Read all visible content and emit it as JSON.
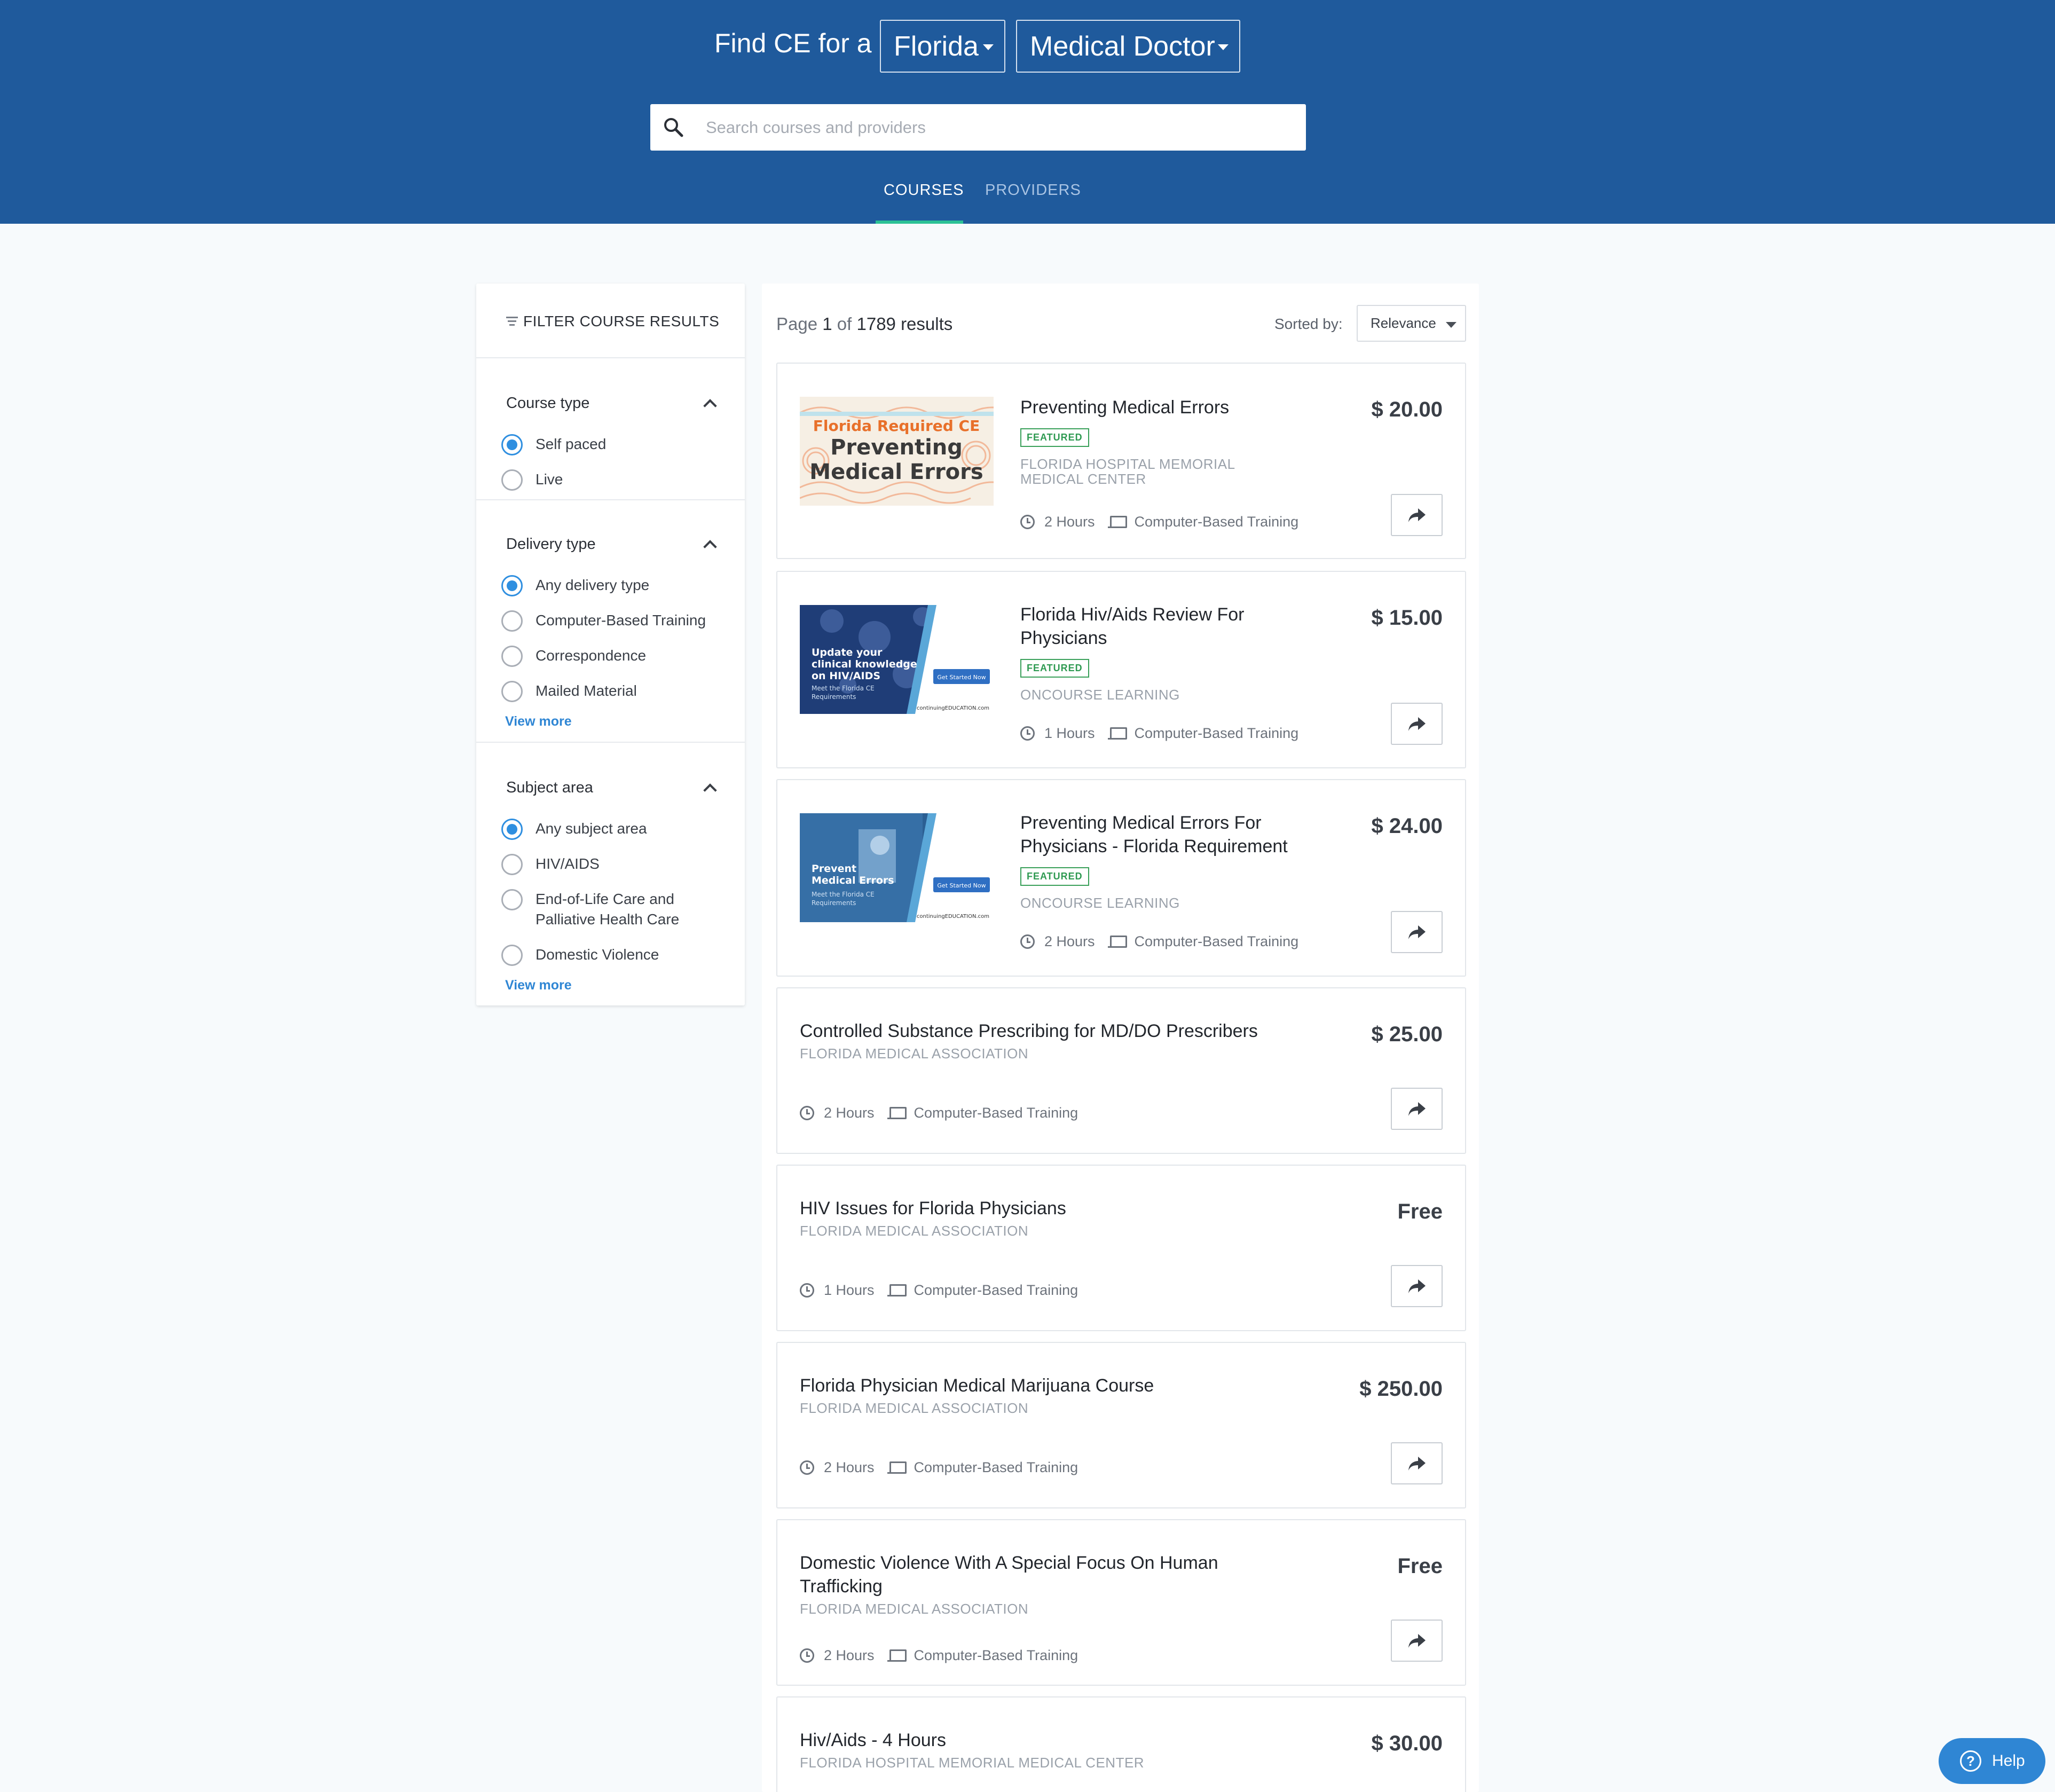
{
  "header": {
    "find_label": "Find CE for a",
    "state": "Florida",
    "profession": "Medical Doctor",
    "search_placeholder": "Search courses and providers",
    "tabs": [
      "COURSES",
      "PROVIDERS"
    ],
    "active_tab": "COURSES"
  },
  "sidebar": {
    "title": "FILTER COURSE RESULTS",
    "course_type": {
      "title": "Course type",
      "options": [
        "Self paced",
        "Live"
      ],
      "selected": "Self paced"
    },
    "delivery_type": {
      "title": "Delivery type",
      "options": [
        "Any delivery type",
        "Computer-Based Training",
        "Correspondence",
        "Mailed Material"
      ],
      "selected": "Any delivery type",
      "view_more": "View more"
    },
    "subject_area": {
      "title": "Subject area",
      "options": [
        "Any subject area",
        "HIV/AIDS",
        "End-of-Life Care and",
        "Palliative Health Care",
        "Domestic Violence"
      ],
      "selected": "Any subject area",
      "view_more": "View more"
    }
  },
  "results": {
    "page_prefix": "Page",
    "page": "1",
    "of": "of",
    "total": "1789 results",
    "sorted_label": "Sorted by:",
    "sort_value": "Relevance",
    "courses": [
      {
        "title": "Preventing Medical Errors",
        "featured": "FEATURED",
        "provider": "FLORIDA HOSPITAL MEMORIAL MEDICAL CENTER",
        "hours": "2 Hours",
        "delivery": "Computer-Based Training",
        "price": "$ 20.00"
      },
      {
        "title": "Florida Hiv/Aids Review For Physicians",
        "featured": "FEATURED",
        "provider": "ONCOURSE LEARNING",
        "hours": "1 Hours",
        "delivery": "Computer-Based Training",
        "price": "$ 15.00"
      },
      {
        "title": "Preventing Medical Errors For Physicians - Florida Requirement",
        "featured": "FEATURED",
        "provider": "ONCOURSE LEARNING",
        "hours": "2 Hours",
        "delivery": "Computer-Based Training",
        "price": "$ 24.00"
      },
      {
        "title": "Controlled Substance Prescribing for MD/DO Prescribers",
        "provider": "FLORIDA MEDICAL ASSOCIATION",
        "hours": "2 Hours",
        "delivery": "Computer-Based Training",
        "price": "$ 25.00"
      },
      {
        "title": "HIV Issues for Florida Physicians",
        "provider": "FLORIDA MEDICAL ASSOCIATION",
        "hours": "1 Hours",
        "delivery": "Computer-Based Training",
        "price": "Free"
      },
      {
        "title": "Florida Physician Medical Marijuana Course",
        "provider": "FLORIDA MEDICAL ASSOCIATION",
        "hours": "2 Hours",
        "delivery": "Computer-Based Training",
        "price": "$ 250.00"
      },
      {
        "title": "Domestic Violence With A Special Focus On Human Trafficking",
        "provider": "FLORIDA MEDICAL ASSOCIATION",
        "hours": "2 Hours",
        "delivery": "Computer-Based Training",
        "price": "Free"
      },
      {
        "title": "Hiv/Aids - 4 Hours",
        "provider": "FLORIDA HOSPITAL MEMORIAL MEDICAL CENTER",
        "price": "$ 30.00"
      }
    ]
  },
  "thumbnails": {
    "t1": {
      "line1": "Florida Required CE",
      "line2": "Preventing",
      "line3": "Medical Errors"
    },
    "t2": {
      "line1": "Update your",
      "line2": "clinical knowledge",
      "line3": "on HIV/AIDS",
      "line4": "Meet the Florida CE",
      "line5": "Requirements",
      "cta": "Get Started Now",
      "brand": "continuingEDUCATION.com"
    },
    "t3": {
      "line1": "Prevent",
      "line2": "Medical Errors",
      "line3": "Meet the Florida CE",
      "line4": "Requirements",
      "cta": "Get Started Now",
      "brand": "continuingEDUCATION.com"
    }
  },
  "help": {
    "label": "Help",
    "icon_glyph": "?"
  },
  "colors": {
    "header_bg": "#1f5a9c",
    "tab_underline": "#2cc195",
    "featured_green": "#2f9a52",
    "radio_blue": "#2f8fe0",
    "help_blue": "#2f86d4"
  }
}
